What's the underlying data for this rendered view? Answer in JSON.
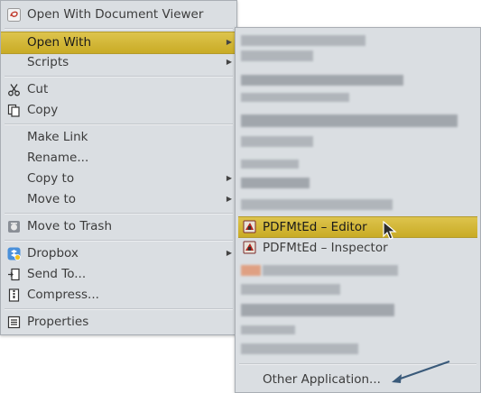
{
  "main_menu": {
    "items": [
      {
        "label": "Open With Document Viewer",
        "icon": "document-viewer-icon"
      },
      {
        "label": "Open With",
        "has_submenu": true,
        "highlighted": true
      },
      {
        "label": "Scripts",
        "has_submenu": true
      },
      {
        "label": "Cut",
        "icon": "scissors-icon"
      },
      {
        "label": "Copy",
        "icon": "copy-icon"
      },
      {
        "label": "Make Link"
      },
      {
        "label": "Rename..."
      },
      {
        "label": "Copy to",
        "has_submenu": true
      },
      {
        "label": "Move to",
        "has_submenu": true
      },
      {
        "label": "Move to Trash",
        "icon": "trash-icon"
      },
      {
        "label": "Dropbox",
        "icon": "dropbox-icon",
        "has_submenu": true
      },
      {
        "label": "Send To...",
        "icon": "send-to-icon"
      },
      {
        "label": "Compress...",
        "icon": "compress-icon"
      },
      {
        "label": "Properties",
        "icon": "properties-icon"
      }
    ]
  },
  "open_with_submenu": {
    "items": [
      {
        "label": "PDFMtEd – Editor",
        "icon": "pdfmted-icon",
        "highlighted": true
      },
      {
        "label": "PDFMtEd – Inspector",
        "icon": "pdfmted-icon"
      }
    ],
    "footer_label": "Other Application..."
  },
  "colors": {
    "menu_bg": "#dadee2",
    "highlight": "#d4b73a",
    "annotation_arrow": "#3a5a7a"
  }
}
